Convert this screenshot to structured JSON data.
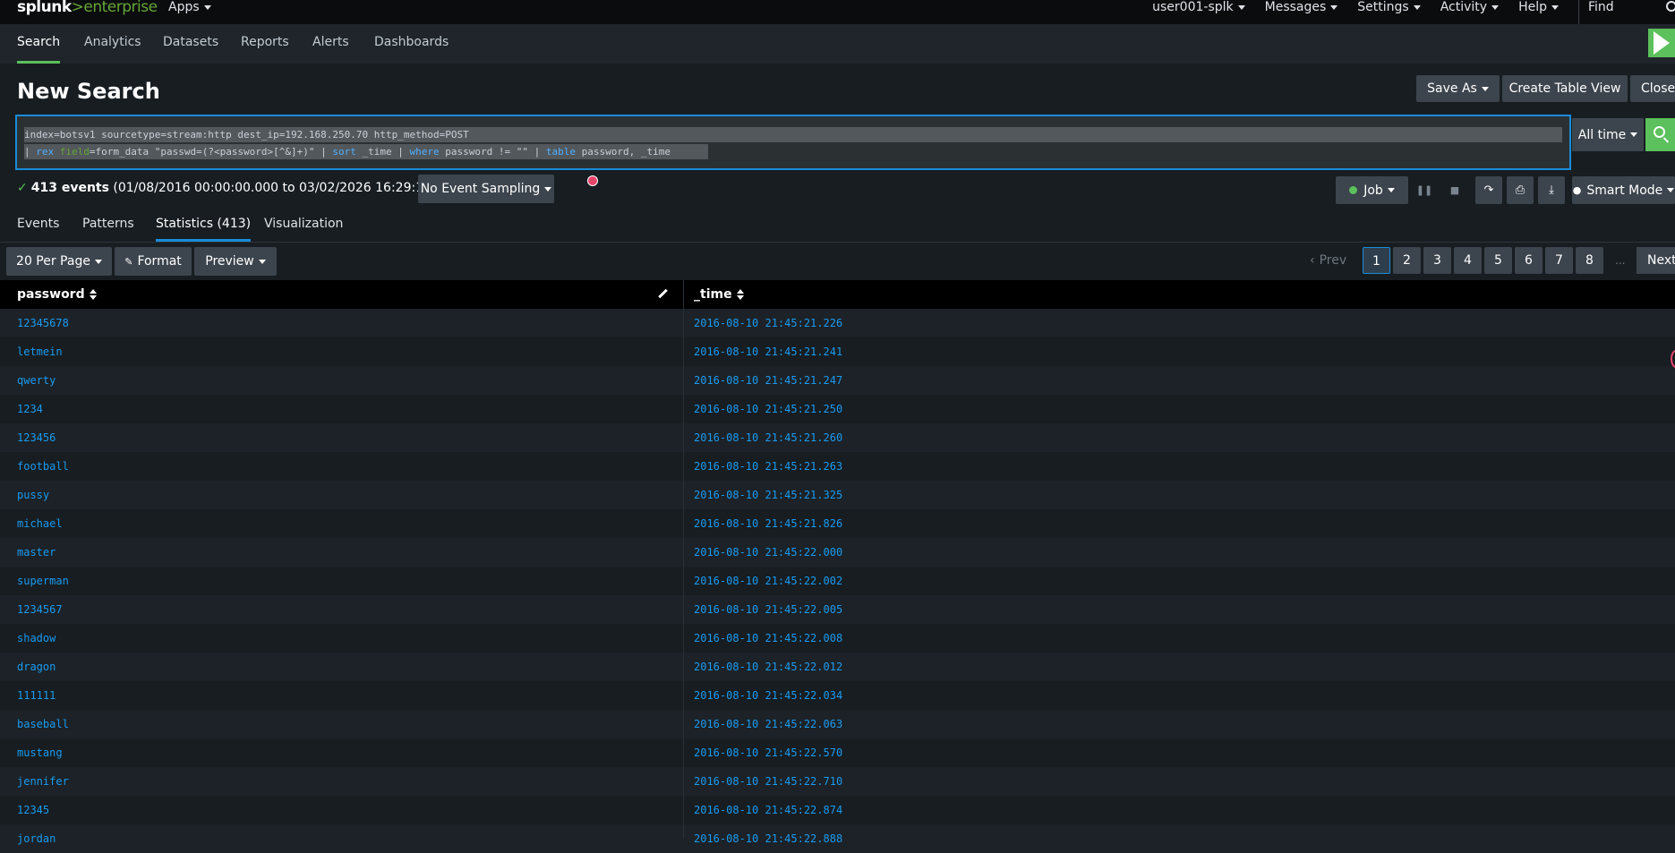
{
  "topbar": {
    "logo_main": "splunk",
    "logo_sep": ">",
    "logo_product": "enterprise",
    "apps_label": "Apps",
    "user": "user001-splk",
    "messages": "Messages",
    "settings": "Settings",
    "activity": "Activity",
    "help": "Help",
    "find": "Find"
  },
  "appnav": {
    "tabs": [
      "Search",
      "Analytics",
      "Datasets",
      "Reports",
      "Alerts",
      "Dashboards"
    ],
    "active": "Search"
  },
  "page": {
    "title": "New Search",
    "save_as": "Save As",
    "create_table_view": "Create Table View",
    "close": "Close"
  },
  "search": {
    "line1": "index=botsv1 sourcetype=stream:http dest_ip=192.168.250.70 http_method=POST",
    "line2": {
      "p1": "| ",
      "rex": "rex",
      "sp1": " ",
      "field": "field",
      "rest1": "=form_data \"passwd=(?<password>[^&]+)\" | ",
      "sort": "sort",
      "rest2": " _time | ",
      "where": "where",
      "rest3": " password != \"\" | ",
      "table": "table",
      "rest4": " password, _time"
    },
    "time_range": "All time"
  },
  "status": {
    "check": "✓",
    "count": "413 events",
    "range": " (01/08/2016 00:00:00.000 to 03/02/2026 16:29:15.000)",
    "sampling": "No Event Sampling",
    "job": "Job",
    "mode": "Smart Mode"
  },
  "result_tabs": [
    "Events",
    "Patterns",
    "Statistics (413)",
    "Visualization"
  ],
  "controls": {
    "per_page": "20 Per Page",
    "format": "Format",
    "preview": "Preview"
  },
  "pager": {
    "prev": "Prev",
    "pages": [
      "1",
      "2",
      "3",
      "4",
      "5",
      "6",
      "7",
      "8"
    ],
    "dots": "...",
    "next": "Next",
    "current": "1"
  },
  "table": {
    "columns": [
      "password",
      "_time"
    ],
    "rows": [
      [
        "12345678",
        "2016-08-10 21:45:21.226"
      ],
      [
        "letmein",
        "2016-08-10 21:45:21.241"
      ],
      [
        "qwerty",
        "2016-08-10 21:45:21.247"
      ],
      [
        "1234",
        "2016-08-10 21:45:21.250"
      ],
      [
        "123456",
        "2016-08-10 21:45:21.260"
      ],
      [
        "football",
        "2016-08-10 21:45:21.263"
      ],
      [
        "pussy",
        "2016-08-10 21:45:21.325"
      ],
      [
        "michael",
        "2016-08-10 21:45:21.826"
      ],
      [
        "master",
        "2016-08-10 21:45:22.000"
      ],
      [
        "superman",
        "2016-08-10 21:45:22.002"
      ],
      [
        "1234567",
        "2016-08-10 21:45:22.005"
      ],
      [
        "shadow",
        "2016-08-10 21:45:22.008"
      ],
      [
        "dragon",
        "2016-08-10 21:45:22.012"
      ],
      [
        "111111",
        "2016-08-10 21:45:22.034"
      ],
      [
        "baseball",
        "2016-08-10 21:45:22.063"
      ],
      [
        "mustang",
        "2016-08-10 21:45:22.570"
      ],
      [
        "jennifer",
        "2016-08-10 21:45:22.710"
      ],
      [
        "12345",
        "2016-08-10 21:45:22.874"
      ],
      [
        "jordan",
        "2016-08-10 21:45:22.888"
      ]
    ]
  },
  "colors": {
    "accent_green": "#5cc05c",
    "link_blue": "#1a9bf0",
    "focus_blue": "#1a8cd8"
  }
}
